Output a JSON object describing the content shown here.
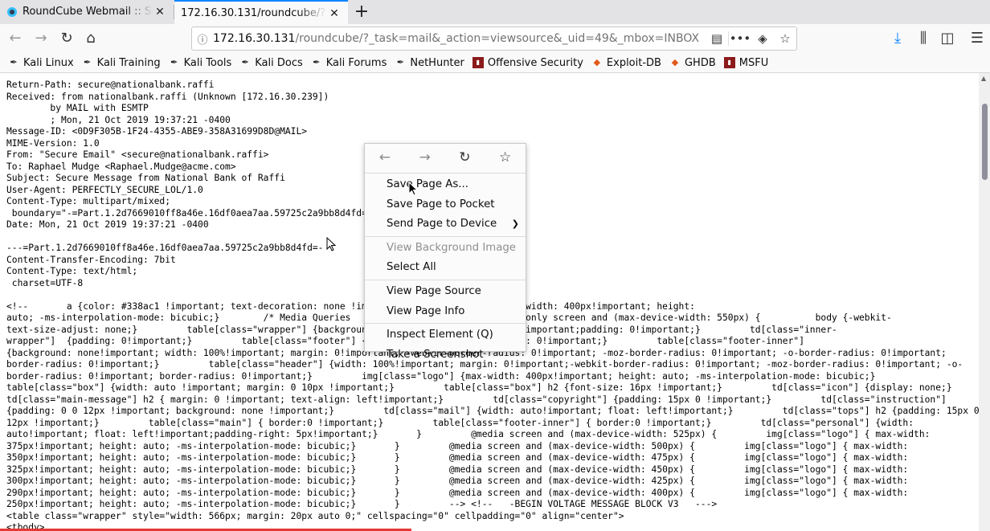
{
  "tabs": [
    {
      "title": "RoundCube Webmail :: Se",
      "active": false
    },
    {
      "title": "172.16.30.131/roundcube/?_t",
      "active": true
    }
  ],
  "new_tab_label": "+",
  "url": {
    "host": "172.16.30.131",
    "path": "/roundcube/?_task=mail&_action=viewsource&_uid=49&_mbox=INBOX"
  },
  "bookmarks": [
    {
      "label": "Kali Linux",
      "icon": "kali-dragon-icon"
    },
    {
      "label": "Kali Training",
      "icon": "kali-dragon-icon"
    },
    {
      "label": "Kali Tools",
      "icon": "kali-dragon-icon"
    },
    {
      "label": "Kali Docs",
      "icon": "kali-dragon-icon"
    },
    {
      "label": "Kali Forums",
      "icon": "kali-dragon-icon"
    },
    {
      "label": "NetHunter",
      "icon": "kali-dragon-icon"
    },
    {
      "label": "Offensive Security",
      "icon": "offsec-icon"
    },
    {
      "label": "Exploit-DB",
      "icon": "exploitdb-icon"
    },
    {
      "label": "GHDB",
      "icon": "exploitdb-icon"
    },
    {
      "label": "MSFU",
      "icon": "offsec-icon"
    }
  ],
  "source_text": "Return-Path: secure@nationalbank.raffi\nReceived: from nationalbank.raffi (Unknown [172.16.30.239])\n        by MAIL with ESMTP\n        ; Mon, 21 Oct 2019 19:37:21 -0400\nMessage-ID: <0D9F305B-1F24-4355-ABE9-358A31699D8D@MAIL>\nMIME-Version: 1.0\nFrom: \"Secure Email\" <secure@nationalbank.raffi>\nTo: Raphael Mudge <Raphael.Mudge@acme.com>\nSubject: Secure Message from National Bank of Raffi\nUser-Agent: PERFECTLY_SECURE_LOL/1.0\nContent-Type: multipart/mixed;\n boundary=\"-=Part.1.2d7669010ff8a46e.16df0aea7aa.59725c2a9bb8d4fd=\nDate: Mon, 21 Oct 2019 19:37:21 -0400\n\n---=Part.1.2d7669010ff8a46e.16df0aea7aa.59725c2a9bb8d4fd=-\nContent-Transfer-Encoding: 7bit\nContent-Type: text/html;\n charset=UTF-8\n\n<!--       a {color: #338ac1 !important; text-decoration: none !important; }       .logo { max-width: 400px!important; height:\nauto; -ms-interpolation-mode: bicubic;}        /* Media Queries                         @media only screen and (max-device-width: 550px) {          body {-webkit-\ntext-size-adjust: none;}         table[class=\"wrapper\"] {background: none!important; margin: 0!important;padding: 0!important;}         td[class=\"inner-\nwrapper\"]  {padding: 0!important;}         table[class=\"footer\"] {width: 100%!important; margin: 0!important;}         table[class=\"footer-inner\"]\n{background: none!important; width: 100%!important; margin: 0!important; -webkit-border-radius: 0!important; -moz-border-radius: 0!important; -o-border-radius: 0!important;\nborder-radius: 0!important;}         table[class=\"header\"] {width: 100%!important; margin: 0!important;-webkit-border-radius: 0!important; -moz-border-radius: 0!important; -o-\nborder-radius: 0!important; border-radius: 0!important;}         img[class=\"logo\"] {max-width: 400px!important; height: auto; -ms-interpolation-mode: bicubic;}\ntable[class=\"box\"] {width: auto !important; margin: 0 10px !important;}         table[class=\"box\"] h2 {font-size: 16px !important;}         td[class=\"icon\"] {display: none;}\ntd[class=\"main-message\"] h2 { margin: 0 !important; text-align: left!important;}         td[class=\"copyright\"] {padding: 15px 0 !important;}         td[class=\"instruction\"]\n{padding: 0 0 12px !important; background: none !important;}         td[class=\"mail\"] {width: auto!important; float: left!important;}         td[class=\"tops\"] h2 {padding: 15px 0\n12px !important;}         table[class=\"main\"] { border:0 !important;}         table[class=\"footer-inner\"] { border:0 !important;}         td[class=\"personal\"] {width:\nauto!important; float: left!important;padding-right: 5px!important;}       }         @media screen and (max-device-width: 525px) {         img[class=\"logo\"] { max-width:\n375px!important; height: auto; -ms-interpolation-mode: bicubic;}       }         @media screen and (max-device-width: 500px) {         img[class=\"logo\"] { max-width:\n350px!important; height: auto; -ms-interpolation-mode: bicubic;}       }         @media screen and (max-device-width: 475px) {         img[class=\"logo\"] { max-width:\n325px!important; height: auto; -ms-interpolation-mode: bicubic;}       }         @media screen and (max-device-width: 450px) {         img[class=\"logo\"] { max-width:\n300px!important; height: auto; -ms-interpolation-mode: bicubic;}       }         @media screen and (max-device-width: 425px) {         img[class=\"logo\"] { max-width:\n290px!important; height: auto; -ms-interpolation-mode: bicubic;}       }         @media screen and (max-device-width: 400px) {         img[class=\"logo\"] { max-width:\n250px!important; height: auto; -ms-interpolation-mode: bicubic;}       }         --> <!--   -BEGIN VOLTAGE MESSAGE BLOCK V3   --->\n<table class=\"wrapper\" style=\"width: 566px; margin: 20px auto 0;\" cellspacing=\"0\" cellpadding=\"0\" align=\"center\">\n<tbody>",
  "context_menu": {
    "items": [
      {
        "label": "Save Page As...",
        "disabled": false,
        "submenu": false
      },
      {
        "label": "Save Page to Pocket",
        "disabled": false,
        "submenu": false
      },
      {
        "label": "Send Page to Device",
        "disabled": false,
        "submenu": true
      },
      {
        "label": "View Background Image",
        "disabled": true,
        "submenu": false
      },
      {
        "label": "Select All",
        "disabled": false,
        "submenu": false
      },
      {
        "label": "View Page Source",
        "disabled": false,
        "submenu": false
      },
      {
        "label": "View Page Info",
        "disabled": false,
        "submenu": false
      },
      {
        "label": "Inspect Element (Q)",
        "disabled": false,
        "submenu": false
      },
      {
        "label": "Take a Screenshot",
        "disabled": false,
        "submenu": false
      }
    ]
  },
  "colors": {
    "accent": "#0a84ff",
    "download": "#0a84ff"
  }
}
